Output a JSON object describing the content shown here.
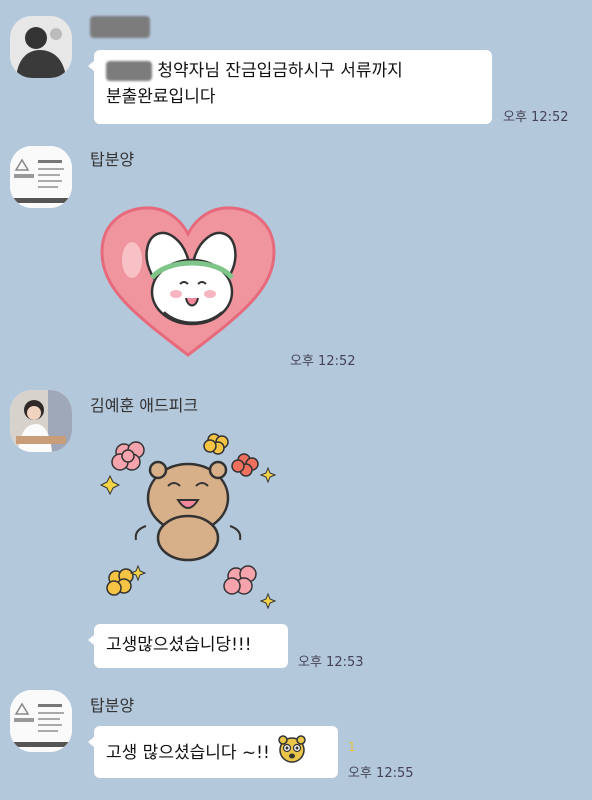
{
  "messages": [
    {
      "sender": "",
      "text_line1": "청약자님 잔금입금하시구 서류까지",
      "text_line2": "분출완료입니다",
      "time": "오후 12:52"
    },
    {
      "sender": "탑분양",
      "time": "오후 12:52",
      "sticker": "heart-bunny-sticker"
    },
    {
      "sender": "김예훈 애드피크",
      "time": "오후 12:53",
      "sticker": "happy-bear-flowers-sticker",
      "text": "고생많으셨습니당!!!"
    },
    {
      "sender": "탑분양",
      "time": "오후 12:55",
      "text": "고생 많으셨습니다 ~!!",
      "unread_count": "1",
      "emoji": "bear-emoticon"
    }
  ],
  "colors": {
    "background": "#b4c8dc",
    "bubble": "#ffffff",
    "heart": "#f0959e",
    "heart_border": "#e76a7c"
  }
}
